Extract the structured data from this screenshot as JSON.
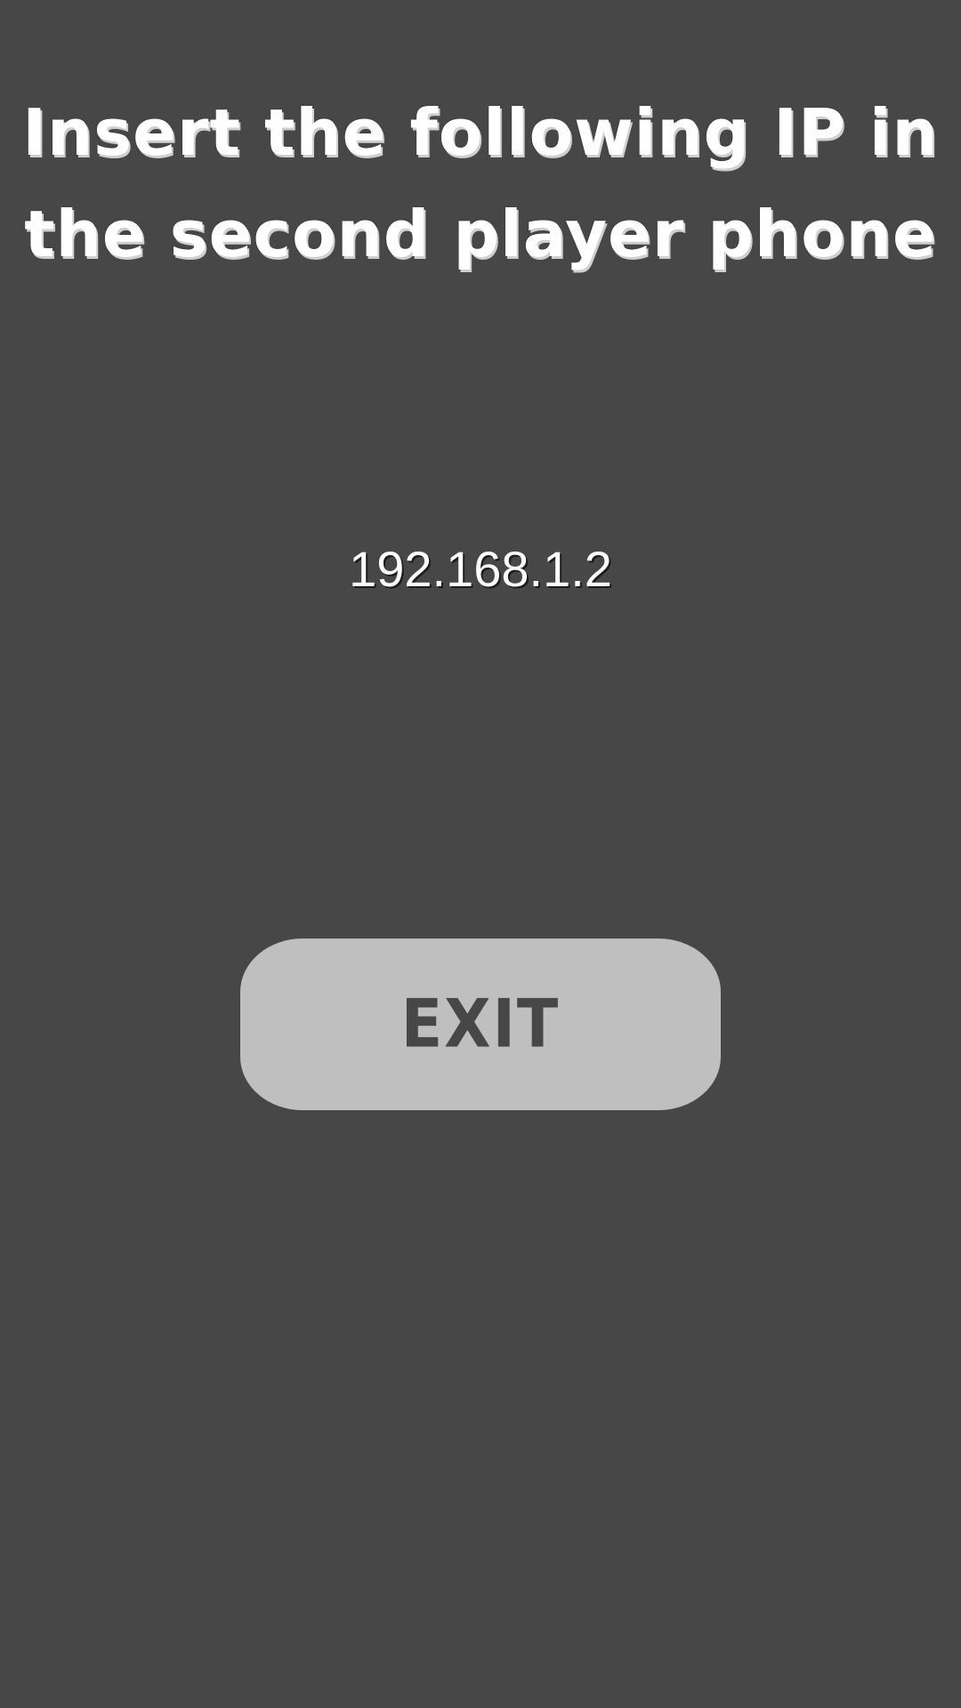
{
  "title": "Insert the following IP in the second player phone",
  "ip_address": "192.168.1.2",
  "exit_button": {
    "label": "EXIT"
  },
  "colors": {
    "background": "#474747",
    "button_background": "#bfbfbf",
    "text": "#ffffff",
    "button_text": "#474747"
  }
}
